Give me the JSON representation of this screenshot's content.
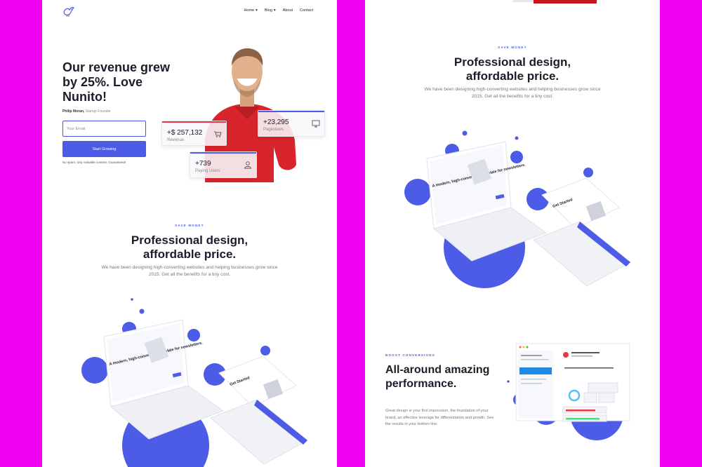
{
  "nav": {
    "items": [
      {
        "label": "Home",
        "has_dropdown": true
      },
      {
        "label": "Blog",
        "has_dropdown": true
      },
      {
        "label": "About",
        "has_dropdown": false
      },
      {
        "label": "Contact",
        "has_dropdown": false
      }
    ]
  },
  "hero": {
    "title": "Our revenue grew by 25%. Love Nunito!",
    "author_name": "Philip Moran,",
    "author_role": "Startup Founder",
    "email_placeholder": "Your Email",
    "cta_label": "Start Growing",
    "disclaimer": "No spam, only valuable content. Guaranteed!"
  },
  "stats": [
    {
      "value": "+$ 257,132",
      "label": "Revenue",
      "icon": "cart-icon",
      "accent": "#e63946"
    },
    {
      "value": "+23,295",
      "label": "Pageviews",
      "icon": "monitor-icon",
      "accent": "#4c5ce6"
    },
    {
      "value": "+739",
      "label": "Paying Users",
      "icon": "user-icon",
      "accent": "#4c5ce6"
    }
  ],
  "pricing": {
    "eyebrow": "SAVE MONEY",
    "title_line1": "Professional design,",
    "title_line2": "affordable price.",
    "desc": "We have been designing high-converting websites and helping businesses grow since 2015. Get all the benefits for a tiny cost."
  },
  "illustration": {
    "laptop_heading": "A modern, high-converting template for newsletters.",
    "tablet_heading": "Get Started"
  },
  "boost": {
    "eyebrow": "BOOST CONVERSIONS",
    "title": "All-around amazing performance.",
    "desc": "Great design is your first impression, the foundation of your brand, an effective leverage for differentiation and growth. See the results in your bottom line."
  },
  "colors": {
    "accent": "#4c5ce6",
    "frame": "#f000f0",
    "red": "#e63946"
  }
}
